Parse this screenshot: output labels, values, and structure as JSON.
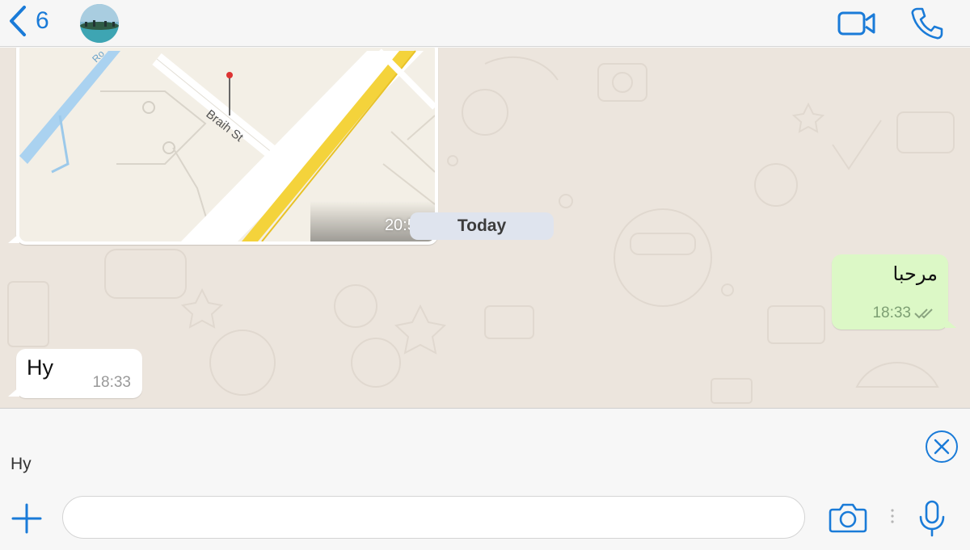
{
  "header": {
    "back_count": "6",
    "accent_color": "#1a7bd8"
  },
  "chat": {
    "map_message": {
      "street_label": "Braih St",
      "time": "20:54"
    },
    "date_separator": "Today",
    "outgoing_message": {
      "text": "مرحبا",
      "time": "18:33",
      "status": "read"
    },
    "incoming_message": {
      "text": "Hy",
      "time": "18:33"
    }
  },
  "reply_preview": {
    "quoted_text": "Hy"
  },
  "composer": {
    "input_value": "",
    "icons": [
      "plus-icon",
      "camera-icon",
      "microphone-icon"
    ]
  }
}
